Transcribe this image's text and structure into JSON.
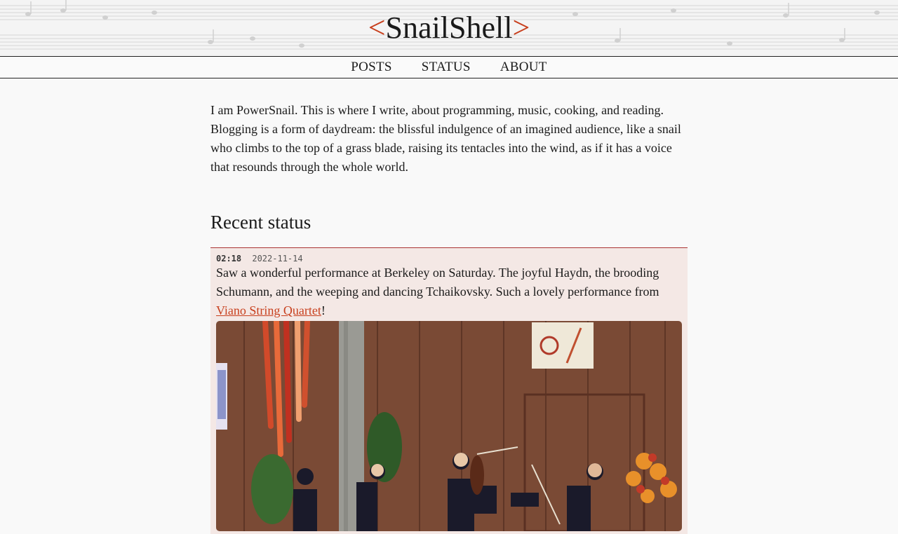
{
  "site": {
    "title_open": "<",
    "title": "SnailShell",
    "title_close": ">"
  },
  "nav": {
    "items": [
      {
        "label": "POSTS"
      },
      {
        "label": "STATUS"
      },
      {
        "label": "ABOUT"
      }
    ]
  },
  "intro": {
    "text": "I am PowerSnail. This is where I write, about programming, music, cooking, and reading. Blogging is a form of daydream: the blissful indulgence of an imagined audience, like a snail who climbs to the top of a grass blade, raising its tentacles into the wind, as if it has a voice that resounds through the whole world."
  },
  "recent_status": {
    "heading": "Recent status",
    "items": [
      {
        "time": "02:18",
        "date": "2022-11-14",
        "text_before": "Saw a wonderful performance at Berkeley on Saturday. The joyful Haydn, the brooding Schumann, and the weeping and dancing Tchaikovsky. Such a lovely performance from ",
        "link_text": "Viano String Quartet",
        "text_after": "!"
      }
    ]
  },
  "colors": {
    "accent": "#c8401e",
    "card_background": "#f4e8e5",
    "card_border": "#aa3333",
    "page_background": "#f9f9f9"
  }
}
